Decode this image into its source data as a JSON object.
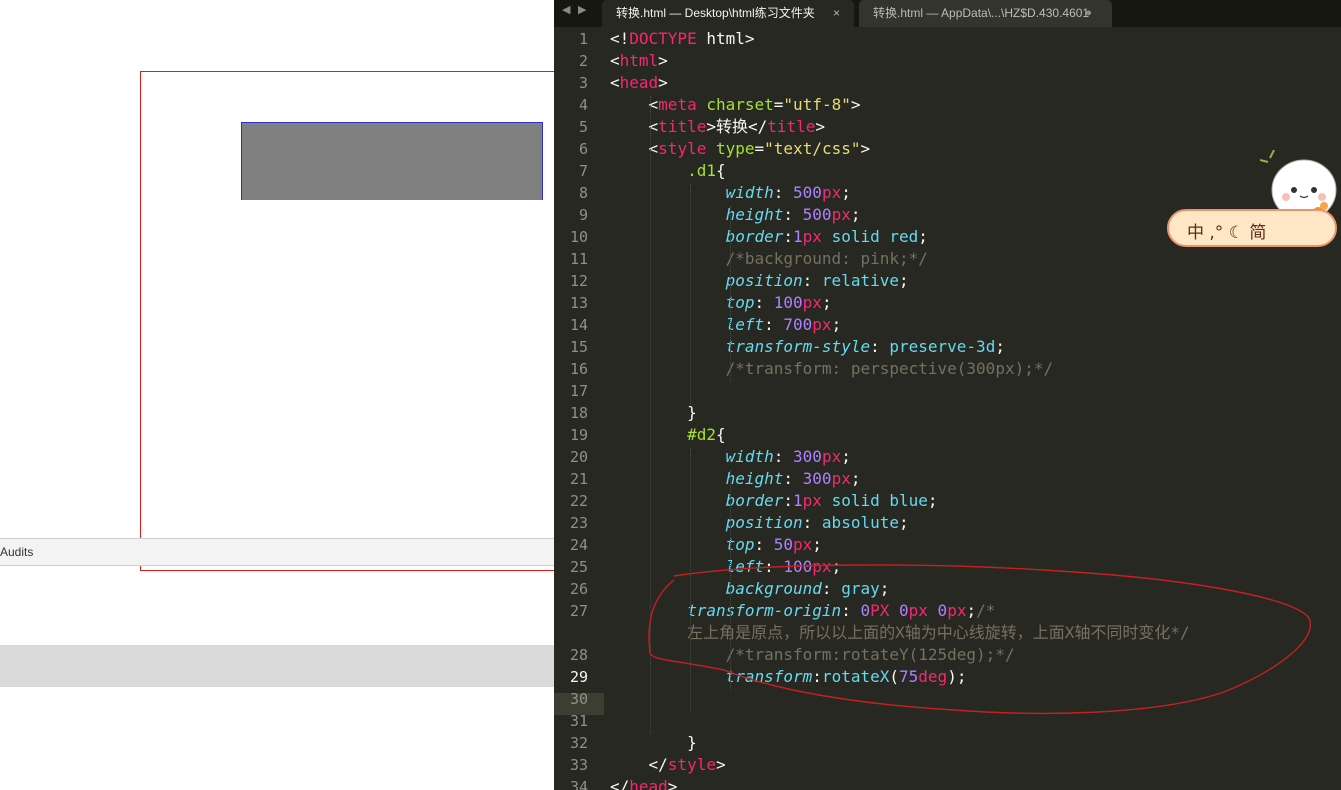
{
  "devtools": {
    "tab_label": "Audits"
  },
  "editor": {
    "tabs": [
      {
        "label": "转换.html — Desktop\\html练习文件夹",
        "close": "×"
      },
      {
        "label": "转换.html — AppData\\...\\HZ$D.430.4601",
        "dirty": "●"
      }
    ],
    "nav": {
      "back": "◀",
      "forward": "▶"
    },
    "line_numbers": [
      "1",
      "2",
      "3",
      "4",
      "5",
      "6",
      "7",
      "8",
      "9",
      "10",
      "11",
      "12",
      "13",
      "14",
      "15",
      "16",
      "17",
      "18",
      "19",
      "20",
      "21",
      "22",
      "23",
      "24",
      "25",
      "26",
      "27",
      "",
      "28",
      "29",
      "30",
      "31",
      "32",
      "33",
      "34"
    ],
    "current_line": "29",
    "code_lines": [
      [
        [
          "w",
          "<!"
        ],
        [
          "p",
          "DOCTYPE"
        ],
        [
          "w",
          " html>"
        ]
      ],
      [
        [
          "w",
          "<"
        ],
        [
          "p",
          "html"
        ],
        [
          "w",
          ">"
        ]
      ],
      [
        [
          "w",
          "<"
        ],
        [
          "p",
          "head"
        ],
        [
          "w",
          ">"
        ]
      ],
      [
        [
          "w",
          "    <"
        ],
        [
          "p",
          "meta"
        ],
        [
          "w",
          " "
        ],
        [
          "g",
          "charset"
        ],
        [
          "w",
          "="
        ],
        [
          "y",
          "\"utf-8\""
        ],
        [
          "w",
          ">"
        ]
      ],
      [
        [
          "w",
          "    <"
        ],
        [
          "p",
          "title"
        ],
        [
          "w",
          ">转换</"
        ],
        [
          "p",
          "title"
        ],
        [
          "w",
          ">"
        ]
      ],
      [
        [
          "w",
          "    <"
        ],
        [
          "p",
          "style"
        ],
        [
          "w",
          " "
        ],
        [
          "g",
          "type"
        ],
        [
          "w",
          "="
        ],
        [
          "y",
          "\"text/css\""
        ],
        [
          "w",
          ">"
        ]
      ],
      [
        [
          "w",
          "        "
        ],
        [
          "g",
          ".d1"
        ],
        [
          "w",
          "{"
        ]
      ],
      [
        [
          "w",
          "            "
        ],
        [
          "i",
          "width"
        ],
        [
          "w",
          ": "
        ],
        [
          "v",
          "500"
        ],
        [
          "p",
          "px"
        ],
        [
          "w",
          ";"
        ]
      ],
      [
        [
          "w",
          "            "
        ],
        [
          "i",
          "height"
        ],
        [
          "w",
          ": "
        ],
        [
          "v",
          "500"
        ],
        [
          "p",
          "px"
        ],
        [
          "w",
          ";"
        ]
      ],
      [
        [
          "w",
          "            "
        ],
        [
          "i",
          "border"
        ],
        [
          "w",
          ":"
        ],
        [
          "v",
          "1"
        ],
        [
          "p",
          "px"
        ],
        [
          "w",
          " "
        ],
        [
          "b",
          "solid"
        ],
        [
          "w",
          " "
        ],
        [
          "b",
          "red"
        ],
        [
          "w",
          ";"
        ]
      ],
      [
        [
          "w",
          "            "
        ],
        [
          "c",
          "/*background: pink;*/"
        ]
      ],
      [
        [
          "w",
          "            "
        ],
        [
          "i",
          "position"
        ],
        [
          "w",
          ": "
        ],
        [
          "b",
          "relative"
        ],
        [
          "w",
          ";"
        ]
      ],
      [
        [
          "w",
          "            "
        ],
        [
          "i",
          "top"
        ],
        [
          "w",
          ": "
        ],
        [
          "v",
          "100"
        ],
        [
          "p",
          "px"
        ],
        [
          "w",
          ";"
        ]
      ],
      [
        [
          "w",
          "            "
        ],
        [
          "i",
          "left"
        ],
        [
          "w",
          ": "
        ],
        [
          "v",
          "700"
        ],
        [
          "p",
          "px"
        ],
        [
          "w",
          ";"
        ]
      ],
      [
        [
          "w",
          "            "
        ],
        [
          "i",
          "transform-style"
        ],
        [
          "w",
          ": "
        ],
        [
          "b",
          "preserve-3d"
        ],
        [
          "w",
          ";"
        ]
      ],
      [
        [
          "w",
          "            "
        ],
        [
          "c",
          "/*transform: perspective(300px);*/"
        ]
      ],
      [
        [
          "w",
          ""
        ]
      ],
      [
        [
          "w",
          "        }"
        ]
      ],
      [
        [
          "w",
          "        "
        ],
        [
          "g",
          "#d2"
        ],
        [
          "w",
          "{"
        ]
      ],
      [
        [
          "w",
          "            "
        ],
        [
          "i",
          "width"
        ],
        [
          "w",
          ": "
        ],
        [
          "v",
          "300"
        ],
        [
          "p",
          "px"
        ],
        [
          "w",
          ";"
        ]
      ],
      [
        [
          "w",
          "            "
        ],
        [
          "i",
          "height"
        ],
        [
          "w",
          ": "
        ],
        [
          "v",
          "300"
        ],
        [
          "p",
          "px"
        ],
        [
          "w",
          ";"
        ]
      ],
      [
        [
          "w",
          "            "
        ],
        [
          "i",
          "border"
        ],
        [
          "w",
          ":"
        ],
        [
          "v",
          "1"
        ],
        [
          "p",
          "px"
        ],
        [
          "w",
          " "
        ],
        [
          "b",
          "solid"
        ],
        [
          "w",
          " "
        ],
        [
          "b",
          "blue"
        ],
        [
          "w",
          ";"
        ]
      ],
      [
        [
          "w",
          "            "
        ],
        [
          "i",
          "position"
        ],
        [
          "w",
          ": "
        ],
        [
          "b",
          "absolute"
        ],
        [
          "w",
          ";"
        ]
      ],
      [
        [
          "w",
          "            "
        ],
        [
          "i",
          "top"
        ],
        [
          "w",
          ": "
        ],
        [
          "v",
          "50"
        ],
        [
          "p",
          "px"
        ],
        [
          "w",
          ";"
        ]
      ],
      [
        [
          "w",
          "            "
        ],
        [
          "i",
          "left"
        ],
        [
          "w",
          ": "
        ],
        [
          "v",
          "100"
        ],
        [
          "p",
          "px"
        ],
        [
          "w",
          ";"
        ]
      ],
      [
        [
          "w",
          "            "
        ],
        [
          "i",
          "background"
        ],
        [
          "w",
          ": "
        ],
        [
          "b",
          "gray"
        ],
        [
          "w",
          ";"
        ]
      ],
      [
        [
          "w",
          "        "
        ],
        [
          "i",
          "transform-origin"
        ],
        [
          "w",
          ": "
        ],
        [
          "v",
          "0"
        ],
        [
          "p",
          "PX"
        ],
        [
          "w",
          " "
        ],
        [
          "v",
          "0"
        ],
        [
          "p",
          "px"
        ],
        [
          "w",
          " "
        ],
        [
          "v",
          "0"
        ],
        [
          "p",
          "px"
        ],
        [
          "w",
          ";"
        ],
        [
          "c",
          "/*"
        ]
      ],
      [
        [
          "w",
          "        "
        ],
        [
          "c",
          "左上角是原点，所以以上面的X轴为中心线旋转，上面X轴不同时变化*/"
        ]
      ],
      [
        [
          "w",
          "            "
        ],
        [
          "c",
          "/*transform:rotateY(125deg);*/"
        ]
      ],
      [
        [
          "w",
          "            "
        ],
        [
          "i",
          "transform"
        ],
        [
          "w",
          ":"
        ],
        [
          "b",
          "rotateX"
        ],
        [
          "w",
          "("
        ],
        [
          "v",
          "75"
        ],
        [
          "p",
          "deg"
        ],
        [
          "w",
          ");"
        ]
      ],
      [
        [
          "w",
          ""
        ]
      ],
      [
        [
          "w",
          ""
        ]
      ],
      [
        [
          "w",
          "        }"
        ]
      ],
      [
        [
          "w",
          "    </"
        ],
        [
          "p",
          "style"
        ],
        [
          "w",
          ">"
        ]
      ],
      [
        [
          "w",
          "</"
        ],
        [
          "p",
          "head"
        ],
        [
          "w",
          ">"
        ]
      ]
    ]
  },
  "ime": {
    "text": "中 ,° ☾ 简"
  },
  "colors": {
    "editor_bg": "#272822",
    "annotation_stroke": "#c8201f",
    "d1_border": "#dd1c1c",
    "d2_fill": "#808080"
  }
}
